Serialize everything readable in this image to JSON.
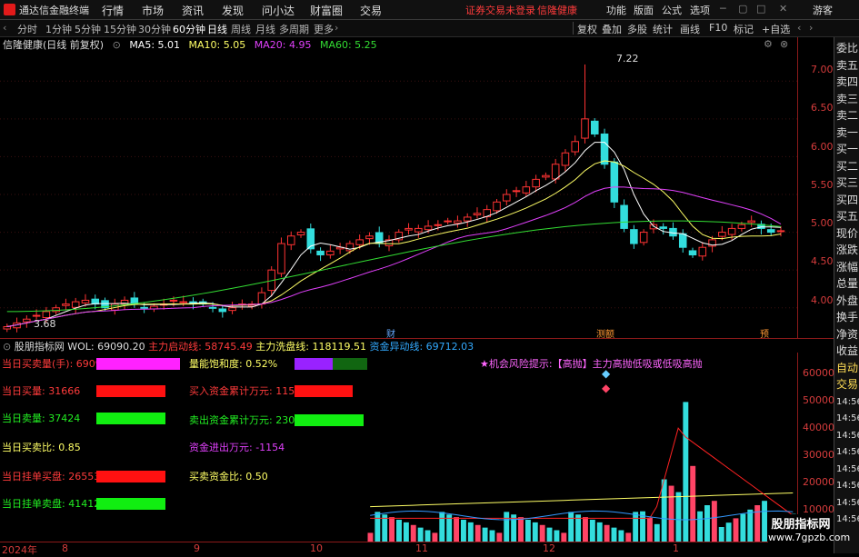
{
  "titlebar": {
    "app": "通达信金融终端",
    "menus": [
      "行情",
      "市场",
      "资讯",
      "发现",
      "问小达",
      "财富圈",
      "交易"
    ],
    "warning": "证券交易未登录",
    "stock": "信隆健康",
    "right": [
      "功能",
      "版面",
      "公式",
      "选项"
    ],
    "user": "游客"
  },
  "periods": [
    "分时",
    "1分钟",
    "5分钟",
    "15分钟",
    "30分钟",
    "60分钟",
    "日线",
    "周线",
    "月线",
    "多周期",
    "更多"
  ],
  "active_period": "日线",
  "tools": [
    "复权",
    "叠加",
    "多股",
    "统计",
    "画线",
    "F10",
    "标记",
    "+自选"
  ],
  "main": {
    "stock_name": "信隆健康(日线 前复权)",
    "ma": [
      {
        "label": "MA5: 5.01",
        "color": "#ffffff"
      },
      {
        "label": "MA10: 5.05",
        "color": "#ffff66"
      },
      {
        "label": "MA20: 4.95",
        "color": "#e040fb"
      },
      {
        "label": "MA60: 5.25",
        "color": "#33dd33"
      }
    ],
    "high_label": "7.22",
    "low_label": "3.68",
    "event_labels": [
      "财",
      "测额",
      "预"
    ]
  },
  "price_axis": [
    "7.00",
    "6.50",
    "6.00",
    "5.50",
    "5.00",
    "4.50",
    "4.00"
  ],
  "right_panel": [
    "委比",
    "卖五",
    "卖四",
    "卖三",
    "卖二",
    "卖一",
    "买一",
    "买二",
    "买三",
    "买四",
    "买五",
    "现价",
    "涨跌",
    "涨幅",
    "总量",
    "外盘",
    "换手",
    "净资",
    "收益",
    "自动",
    "交易",
    "14:56",
    "14:56",
    "14:56",
    "14:56",
    "14:56",
    "14:56",
    "14:56",
    "14:56"
  ],
  "sub": {
    "name": "股朋指标网",
    "vol": "WOL: 69090.20",
    "f1": "主力启动线: 58745.49",
    "f2": "主力洗盘线: 118119.51",
    "f3": "资金异动线: 69712.03",
    "risk": "★机会风险提示:【高抛】主力高抛低吸或低吸高抛"
  },
  "indicators": {
    "left": [
      {
        "label": "当日买卖量(手): 69090",
        "color": "#ff3b3b"
      },
      {
        "label": "当日买量: 31666",
        "color": "#ff3b3b"
      },
      {
        "label": "当日卖量: 37424",
        "color": "#22ee22"
      },
      {
        "label": "当日买卖比: 0.85",
        "color": "#ffff66"
      },
      {
        "label": "当日挂单买盘: 26553",
        "color": "#ff3b3b"
      },
      {
        "label": "当日挂单卖盘: 41412",
        "color": "#22ee22"
      }
    ],
    "mid": [
      {
        "label": "量能饱和度: 0.52%",
        "color": "#ffff66"
      },
      {
        "label": "买入资金累计万元: 1154",
        "color": "#ff3b3b"
      },
      {
        "label": "卖出资金累计万元: 2308",
        "color": "#22ee22"
      },
      {
        "label": "资金进出万元: -1154",
        "color": "#e040fb"
      },
      {
        "label": "买卖资金比: 0.50",
        "color": "#ffff66"
      }
    ]
  },
  "volume_axis": [
    "60000",
    "50000",
    "40000",
    "30000",
    "20000",
    "10000"
  ],
  "dates": [
    "2024年",
    "8",
    "9",
    "10",
    "11",
    "12",
    "1"
  ],
  "watermark": {
    "line1": "股朋指标网",
    "line2": "www.7gpzb.com"
  },
  "chart_data": {
    "type": "candlestick",
    "y_axis_ticks": [
      7.0,
      6.5,
      6.0,
      5.5,
      5.0,
      4.5,
      4.0
    ],
    "ylim": [
      3.6,
      7.4
    ],
    "annotations": {
      "max": 7.22,
      "min": 3.68
    },
    "ma_values": {
      "MA5": 5.01,
      "MA10": 5.05,
      "MA20": 4.95,
      "MA60": 5.25
    },
    "closes": [
      3.75,
      3.8,
      3.85,
      3.9,
      3.95,
      4.0,
      4.05,
      4.08,
      4.1,
      4.05,
      4.0,
      4.05,
      4.1,
      4.05,
      4.0,
      4.02,
      4.05,
      4.1,
      4.08,
      4.05,
      4.05,
      4.0,
      3.95,
      4.0,
      4.05,
      4.05,
      4.2,
      4.5,
      4.85,
      4.95,
      5.0,
      4.78,
      4.7,
      4.75,
      4.8,
      4.85,
      4.9,
      4.95,
      4.85,
      4.9,
      5.0,
      5.05,
      5.05,
      5.08,
      5.1,
      5.15,
      5.15,
      5.2,
      5.25,
      5.3,
      5.4,
      5.5,
      5.55,
      5.6,
      5.7,
      5.75,
      5.9,
      6.05,
      6.2,
      6.5,
      6.3,
      5.9,
      5.4,
      5.05,
      4.85,
      5.0,
      5.1,
      5.05,
      4.95,
      4.8,
      4.7,
      4.8,
      4.9,
      5.0,
      5.05,
      5.1,
      5.15,
      5.05,
      5.0,
      5.02
    ],
    "volume_ylim": [
      0,
      65000
    ],
    "volume_ticks": [
      60000,
      50000,
      40000,
      30000,
      20000,
      10000
    ]
  }
}
